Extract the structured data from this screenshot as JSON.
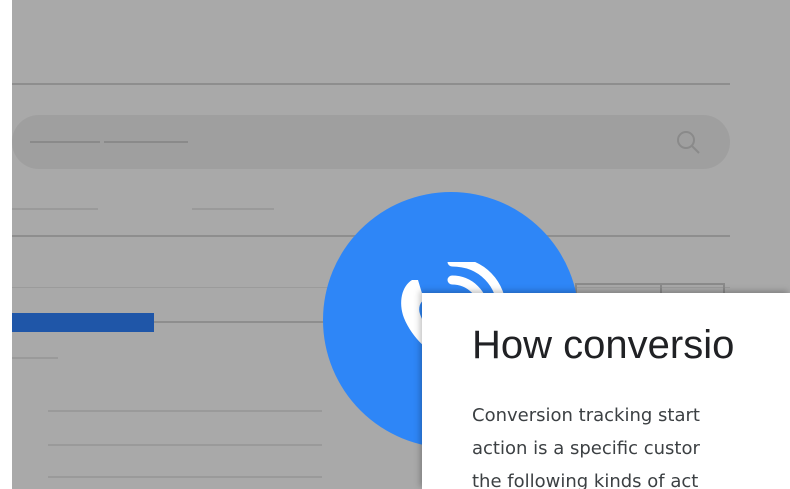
{
  "card": {
    "title": "How conversio",
    "body_lines": [
      "Conversion tracking start",
      "action is a specific custor",
      "the following kinds of act"
    ]
  },
  "icons": {
    "search": "search-icon",
    "phone": "phone-call-icon"
  },
  "colors": {
    "backdrop": "#a9a9a9",
    "circle": "#2e86f7",
    "blue_bar": "#1f56a8",
    "card": "#ffffff"
  }
}
